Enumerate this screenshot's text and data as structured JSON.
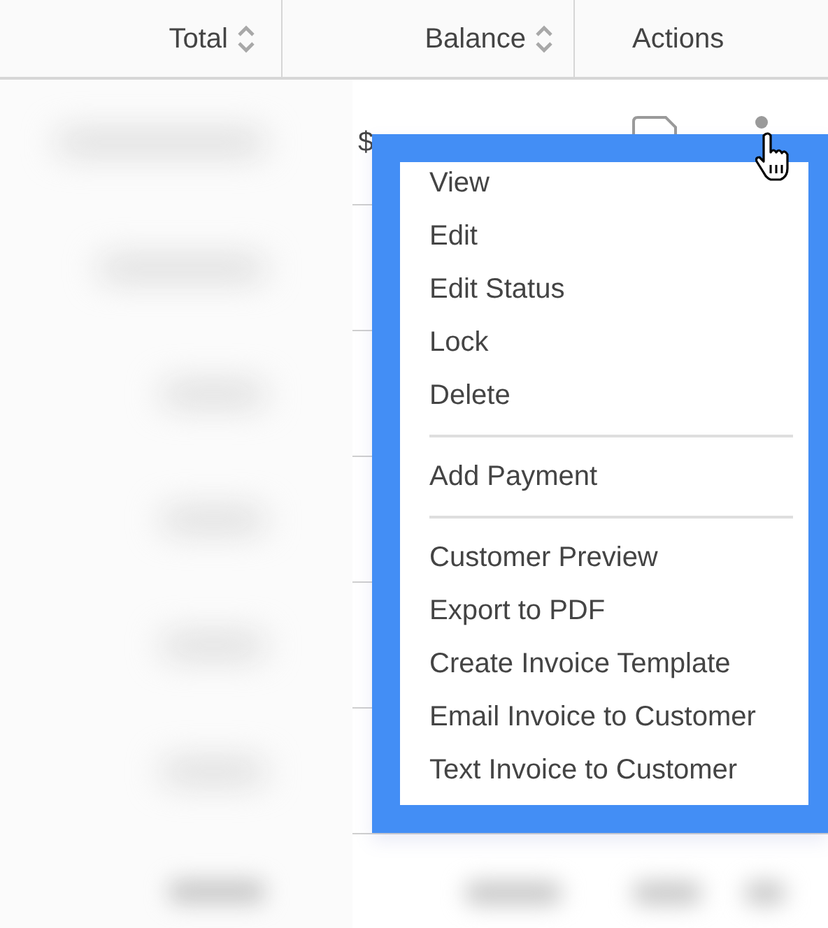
{
  "table": {
    "columns": [
      {
        "label": "Total",
        "sortable": true
      },
      {
        "label": "Balance",
        "sortable": true
      },
      {
        "label": "Actions",
        "sortable": false
      }
    ],
    "rows": [
      {
        "balance": "$"
      }
    ]
  },
  "action_menu": {
    "sections": [
      {
        "items": [
          "View",
          "Edit",
          "Edit Status",
          "Lock",
          "Delete"
        ]
      },
      {
        "items": [
          "Add Payment"
        ]
      },
      {
        "items": [
          "Customer Preview",
          "Export to PDF",
          "Create Invoice Template",
          "Email Invoice to Customer",
          "Text Invoice to Customer"
        ]
      }
    ]
  }
}
